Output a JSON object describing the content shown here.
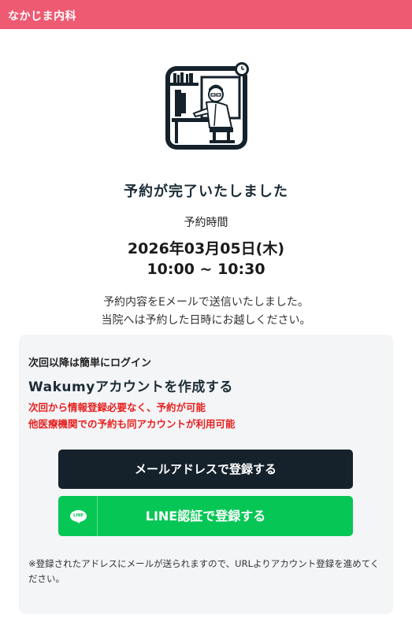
{
  "header": {
    "clinic_name": "なかじま内科"
  },
  "illustration": {
    "icon": "doctor-at-desk-illustration"
  },
  "confirmation": {
    "title": "予約が完了いたしました",
    "time_label": "予約時間",
    "date": "2026年03月05日(木)",
    "time_range": "10:00 ~ 10:30",
    "message_line1": "予約内容をEメールで送信いたしました。",
    "message_line2": "当院へは予約した日時にお越しください。"
  },
  "signup": {
    "login_note": "次回以降は簡単にログイン",
    "title": "Wakumyアカウントを作成する",
    "benefit_line1": "次回から情報登録必要なく、予約が可能",
    "benefit_line2": "他医療機関での予約も同アカウントが利用可能",
    "email_button": "メールアドレスで登録する",
    "line_button": "LINE認証で登録する",
    "line_icon_text": "LINE",
    "footnote": "※登録されたアドレスにメールが送られますので、URLよりアカウント登録を進めてください。"
  },
  "colors": {
    "header_bg": "#ee5a72",
    "primary_dark": "#15222b",
    "line_green": "#06c755",
    "benefit_red": "#e8201f",
    "panel_bg": "#f4f5f7"
  }
}
